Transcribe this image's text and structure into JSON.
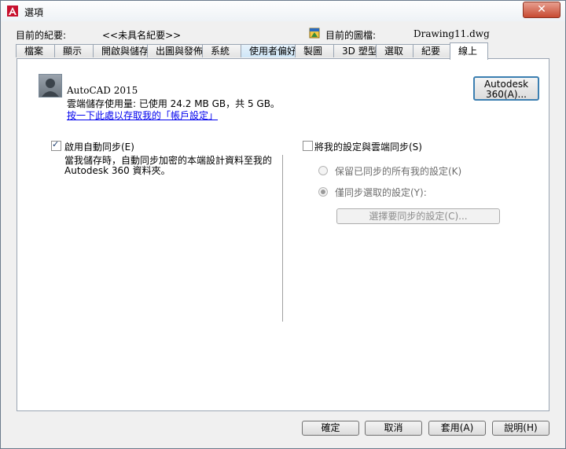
{
  "window": {
    "title": "選項",
    "close_glyph": "✕"
  },
  "info": {
    "profile_label": "目前的紀要:",
    "profile_value": "<<未具名紀要>>",
    "drawing_label": "目前的圖檔:",
    "drawing_value": "Drawing11.dwg"
  },
  "tabs": [
    "檔案",
    "顯示",
    "開啟與儲存",
    "出圖與發佈",
    "系統",
    "使用者偏好",
    "製圖",
    "3D 塑型",
    "選取",
    "紀要",
    "線上"
  ],
  "selected_tab": "線上",
  "account": {
    "product": "AutoCAD 2015",
    "storage": "雲端儲存使用量: 已使用 24.2 MB GB，共 5 GB。",
    "link": "按一下此處以存取我的「帳戶設定」",
    "a360_button_line1": "Autodesk",
    "a360_button_line2": "360(A)..."
  },
  "auto_sync": {
    "checkbox_label": "啟用自動同步(E)",
    "checked": true,
    "desc_line1": "當我儲存時，自動同步加密的本端設計資料至我的",
    "desc_line2": "Autodesk 360 資料夾。"
  },
  "settings_sync": {
    "checkbox_label": "將我的設定與雲端同步(S)",
    "checked": false,
    "radio_all": "保留已同步的所有我的設定(K)",
    "radio_selected": "僅同步選取的設定(Y):",
    "selected_radio": "radio_selected",
    "select_button": "選擇要同步的設定(C)..."
  },
  "footer": {
    "ok": "確定",
    "cancel": "取消",
    "apply": "套用(A)",
    "help": "說明(H)"
  },
  "colors": {
    "titlebar": "#eef2f6",
    "close_button": "#c74a32",
    "link": "#0000ee",
    "a360_border": "#3c7fb1"
  }
}
